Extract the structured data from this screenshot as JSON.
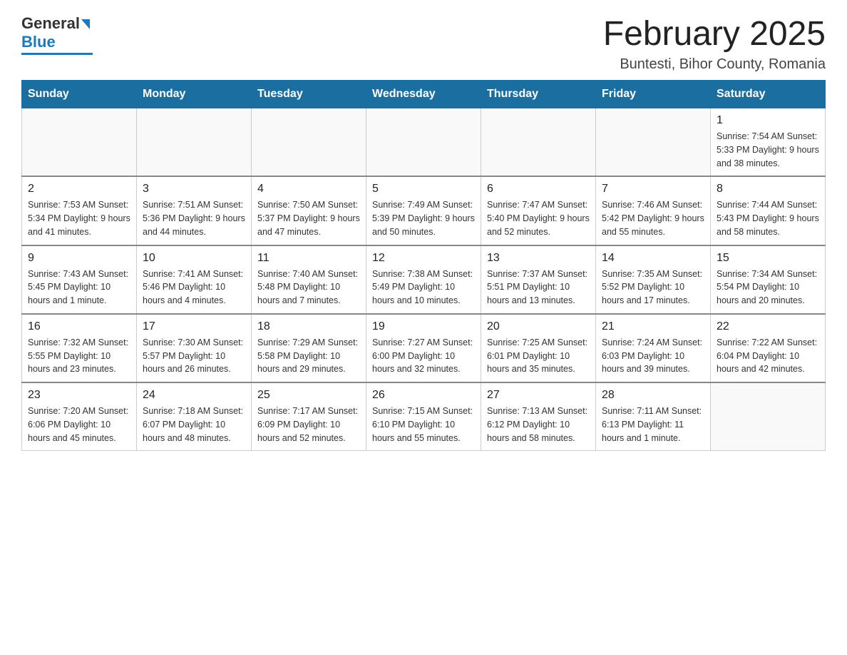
{
  "header": {
    "month_title": "February 2025",
    "subtitle": "Buntesti, Bihor County, Romania",
    "logo_general": "General",
    "logo_blue": "Blue"
  },
  "days_of_week": [
    "Sunday",
    "Monday",
    "Tuesday",
    "Wednesday",
    "Thursday",
    "Friday",
    "Saturday"
  ],
  "weeks": [
    [
      {
        "day": "",
        "info": ""
      },
      {
        "day": "",
        "info": ""
      },
      {
        "day": "",
        "info": ""
      },
      {
        "day": "",
        "info": ""
      },
      {
        "day": "",
        "info": ""
      },
      {
        "day": "",
        "info": ""
      },
      {
        "day": "1",
        "info": "Sunrise: 7:54 AM\nSunset: 5:33 PM\nDaylight: 9 hours and 38 minutes."
      }
    ],
    [
      {
        "day": "2",
        "info": "Sunrise: 7:53 AM\nSunset: 5:34 PM\nDaylight: 9 hours and 41 minutes."
      },
      {
        "day": "3",
        "info": "Sunrise: 7:51 AM\nSunset: 5:36 PM\nDaylight: 9 hours and 44 minutes."
      },
      {
        "day": "4",
        "info": "Sunrise: 7:50 AM\nSunset: 5:37 PM\nDaylight: 9 hours and 47 minutes."
      },
      {
        "day": "5",
        "info": "Sunrise: 7:49 AM\nSunset: 5:39 PM\nDaylight: 9 hours and 50 minutes."
      },
      {
        "day": "6",
        "info": "Sunrise: 7:47 AM\nSunset: 5:40 PM\nDaylight: 9 hours and 52 minutes."
      },
      {
        "day": "7",
        "info": "Sunrise: 7:46 AM\nSunset: 5:42 PM\nDaylight: 9 hours and 55 minutes."
      },
      {
        "day": "8",
        "info": "Sunrise: 7:44 AM\nSunset: 5:43 PM\nDaylight: 9 hours and 58 minutes."
      }
    ],
    [
      {
        "day": "9",
        "info": "Sunrise: 7:43 AM\nSunset: 5:45 PM\nDaylight: 10 hours and 1 minute."
      },
      {
        "day": "10",
        "info": "Sunrise: 7:41 AM\nSunset: 5:46 PM\nDaylight: 10 hours and 4 minutes."
      },
      {
        "day": "11",
        "info": "Sunrise: 7:40 AM\nSunset: 5:48 PM\nDaylight: 10 hours and 7 minutes."
      },
      {
        "day": "12",
        "info": "Sunrise: 7:38 AM\nSunset: 5:49 PM\nDaylight: 10 hours and 10 minutes."
      },
      {
        "day": "13",
        "info": "Sunrise: 7:37 AM\nSunset: 5:51 PM\nDaylight: 10 hours and 13 minutes."
      },
      {
        "day": "14",
        "info": "Sunrise: 7:35 AM\nSunset: 5:52 PM\nDaylight: 10 hours and 17 minutes."
      },
      {
        "day": "15",
        "info": "Sunrise: 7:34 AM\nSunset: 5:54 PM\nDaylight: 10 hours and 20 minutes."
      }
    ],
    [
      {
        "day": "16",
        "info": "Sunrise: 7:32 AM\nSunset: 5:55 PM\nDaylight: 10 hours and 23 minutes."
      },
      {
        "day": "17",
        "info": "Sunrise: 7:30 AM\nSunset: 5:57 PM\nDaylight: 10 hours and 26 minutes."
      },
      {
        "day": "18",
        "info": "Sunrise: 7:29 AM\nSunset: 5:58 PM\nDaylight: 10 hours and 29 minutes."
      },
      {
        "day": "19",
        "info": "Sunrise: 7:27 AM\nSunset: 6:00 PM\nDaylight: 10 hours and 32 minutes."
      },
      {
        "day": "20",
        "info": "Sunrise: 7:25 AM\nSunset: 6:01 PM\nDaylight: 10 hours and 35 minutes."
      },
      {
        "day": "21",
        "info": "Sunrise: 7:24 AM\nSunset: 6:03 PM\nDaylight: 10 hours and 39 minutes."
      },
      {
        "day": "22",
        "info": "Sunrise: 7:22 AM\nSunset: 6:04 PM\nDaylight: 10 hours and 42 minutes."
      }
    ],
    [
      {
        "day": "23",
        "info": "Sunrise: 7:20 AM\nSunset: 6:06 PM\nDaylight: 10 hours and 45 minutes."
      },
      {
        "day": "24",
        "info": "Sunrise: 7:18 AM\nSunset: 6:07 PM\nDaylight: 10 hours and 48 minutes."
      },
      {
        "day": "25",
        "info": "Sunrise: 7:17 AM\nSunset: 6:09 PM\nDaylight: 10 hours and 52 minutes."
      },
      {
        "day": "26",
        "info": "Sunrise: 7:15 AM\nSunset: 6:10 PM\nDaylight: 10 hours and 55 minutes."
      },
      {
        "day": "27",
        "info": "Sunrise: 7:13 AM\nSunset: 6:12 PM\nDaylight: 10 hours and 58 minutes."
      },
      {
        "day": "28",
        "info": "Sunrise: 7:11 AM\nSunset: 6:13 PM\nDaylight: 11 hours and 1 minute."
      },
      {
        "day": "",
        "info": ""
      }
    ]
  ]
}
